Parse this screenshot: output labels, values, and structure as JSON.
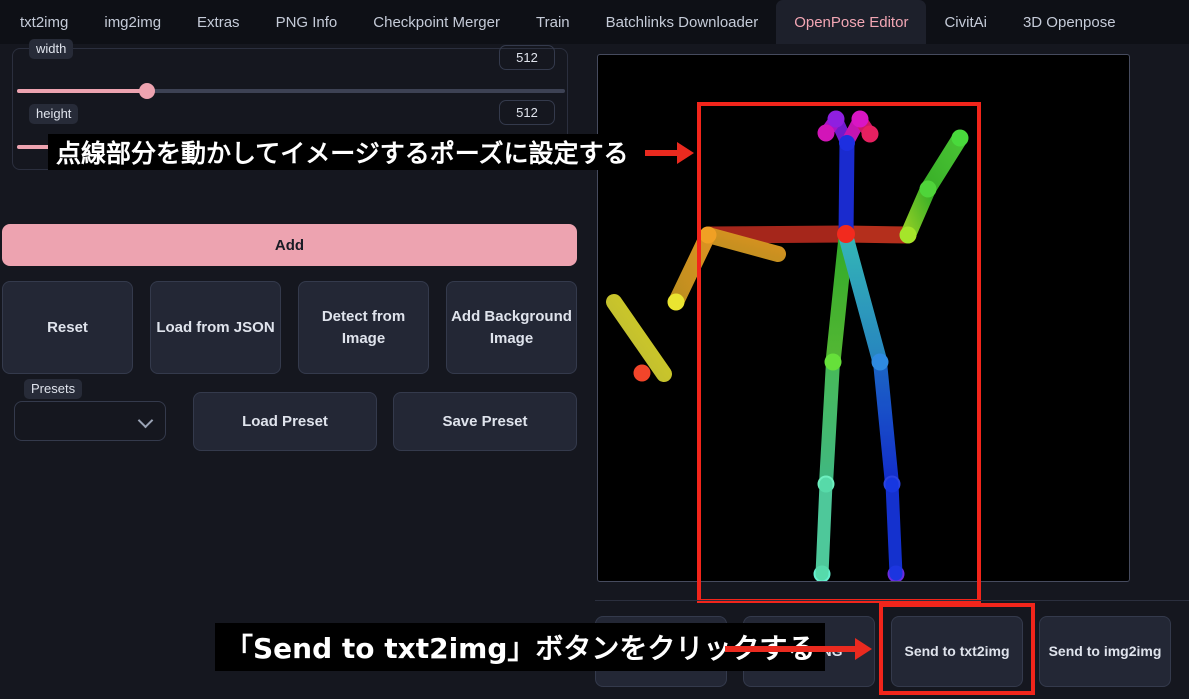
{
  "tabs": [
    {
      "label": "txt2img",
      "active": false
    },
    {
      "label": "img2img",
      "active": false
    },
    {
      "label": "Extras",
      "active": false
    },
    {
      "label": "PNG Info",
      "active": false
    },
    {
      "label": "Checkpoint Merger",
      "active": false
    },
    {
      "label": "Train",
      "active": false
    },
    {
      "label": "Batchlinks Downloader",
      "active": false
    },
    {
      "label": "OpenPose Editor",
      "active": true
    },
    {
      "label": "CivitAi",
      "active": false
    },
    {
      "label": "3D Openpose",
      "active": false
    }
  ],
  "controls": {
    "width": {
      "label": "width",
      "value": "512"
    },
    "height": {
      "label": "height",
      "value": "512"
    }
  },
  "buttons": {
    "add": "Add",
    "reset": "Reset",
    "load_from_json": "Load from JSON",
    "detect_from_image": "Detect from Image",
    "add_background_image": "Add Background Image",
    "load_preset": "Load Preset",
    "save_preset": "Save Preset"
  },
  "presets": {
    "label": "Presets",
    "value": ""
  },
  "bottom_buttons": [
    {
      "label": "",
      "highlighted": false
    },
    {
      "label": "Save PNG",
      "highlighted": false
    },
    {
      "label": "Send to txt2img",
      "highlighted": true
    },
    {
      "label": "Send to img2img",
      "highlighted": false
    }
  ],
  "annotations": {
    "top": "点線部分を動かしてイメージするポーズに設定する",
    "bottom": "「Send to txt2img」ボタンをクリックする"
  },
  "colors": {
    "accent_pink": "#eda3b0",
    "annotation_red": "#ea2a1f",
    "page_bg": "#15171f",
    "panel_bg": "#232735",
    "canvas_bg": "#000000"
  }
}
